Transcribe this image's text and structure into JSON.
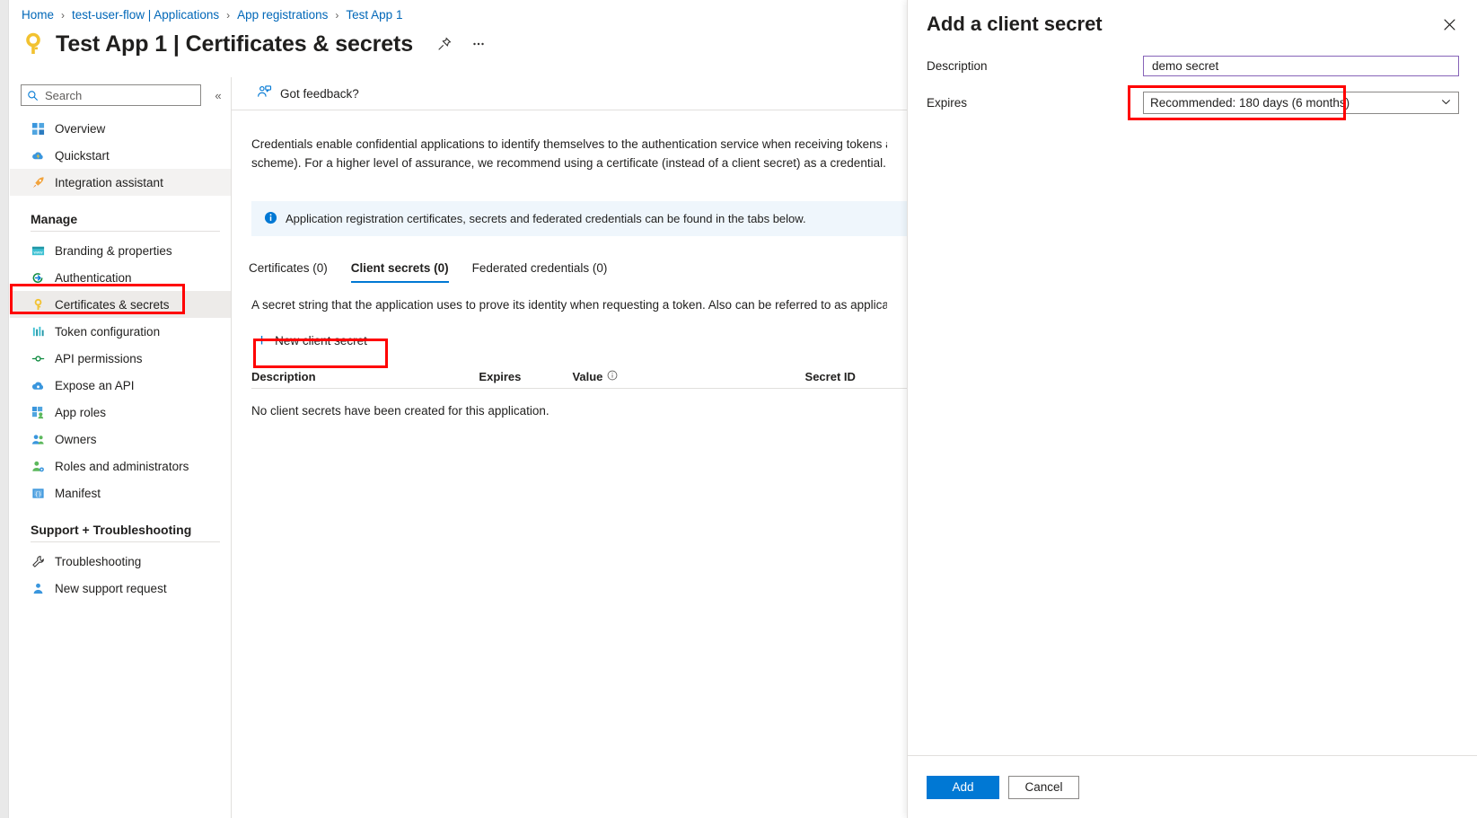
{
  "breadcrumb": {
    "items": [
      {
        "label": "Home"
      },
      {
        "label": "test-user-flow | Applications"
      },
      {
        "label": "App registrations"
      },
      {
        "label": "Test App 1"
      }
    ],
    "separator": "›"
  },
  "header": {
    "title": "Test App 1 | Certificates & secrets",
    "icon": "key-icon",
    "pin_icon": "pin-icon",
    "more_icon": "ellipsis-icon"
  },
  "sidebar": {
    "search": {
      "placeholder": "Search",
      "value": "",
      "icon": "search-icon"
    },
    "collapse_icon": "chevron-double-left-icon",
    "items": [
      {
        "label": "Overview",
        "icon": "grid-icon",
        "selected": false
      },
      {
        "label": "Quickstart",
        "icon": "cloud-bolt-icon",
        "selected": false
      },
      {
        "label": "Integration assistant",
        "icon": "rocket-icon",
        "selected": false
      }
    ],
    "manage_group": "Manage",
    "manage_items": [
      {
        "label": "Branding & properties",
        "icon": "window-icon",
        "selected": false
      },
      {
        "label": "Authentication",
        "icon": "arrow-in-icon",
        "selected": false
      },
      {
        "label": "Certificates & secrets",
        "icon": "key-icon",
        "selected": true
      },
      {
        "label": "Token configuration",
        "icon": "bars-icon",
        "selected": false
      },
      {
        "label": "API permissions",
        "icon": "api-icon",
        "selected": false
      },
      {
        "label": "Expose an API",
        "icon": "cloud-api-icon",
        "selected": false
      },
      {
        "label": "App roles",
        "icon": "app-roles-icon",
        "selected": false
      },
      {
        "label": "Owners",
        "icon": "people-icon",
        "selected": false
      },
      {
        "label": "Roles and administrators",
        "icon": "person-gear-icon",
        "selected": false
      },
      {
        "label": "Manifest",
        "icon": "manifest-icon",
        "selected": false
      }
    ],
    "support_group": "Support + Troubleshooting",
    "support_items": [
      {
        "label": "Troubleshooting",
        "icon": "wrench-icon",
        "selected": false
      },
      {
        "label": "New support request",
        "icon": "support-icon",
        "selected": false
      }
    ]
  },
  "main": {
    "feedback_label": "Got feedback?",
    "feedback_icon": "feedback-person-icon",
    "description_line1": "Credentials enable confidential applications to identify themselves to the authentication service when receiving tokens at a web addr",
    "description_line2": "scheme). For a higher level of assurance, we recommend using a certificate (instead of a client secret) as a credential.",
    "info_icon": "info-icon",
    "info_message": "Application registration certificates, secrets and federated credentials can be found in the tabs below.",
    "tabs": [
      {
        "label": "Certificates (0)",
        "active": false
      },
      {
        "label": "Client secrets (0)",
        "active": true
      },
      {
        "label": "Federated credentials (0)",
        "active": false
      }
    ],
    "tab_description": "A secret string that the application uses to prove its identity when requesting a token. Also can be referred to as application passw",
    "new_secret_label": "New client secret",
    "new_secret_icon": "plus-icon",
    "table": {
      "columns": [
        "Description",
        "Expires",
        "Value",
        "Secret ID"
      ],
      "value_info_icon": "info-circle-icon",
      "rows": [],
      "empty_message": "No client secrets have been created for this application."
    }
  },
  "panel": {
    "title": "Add a client secret",
    "close_icon": "close-icon",
    "fields": {
      "description_label": "Description",
      "description_value": "demo secret",
      "description_placeholder": "",
      "expires_label": "Expires",
      "expires_value": "Recommended: 180 days (6 months)",
      "expires_chevron_icon": "chevron-down-icon"
    },
    "footer": {
      "add_label": "Add",
      "cancel_label": "Cancel"
    }
  },
  "colors": {
    "accent": "#0078d4",
    "link": "#0067b8",
    "annotation": "#ff0000",
    "info_bg": "#eff6fc",
    "focus_border": "#8764b8",
    "selected_bg": "#edebe9"
  }
}
